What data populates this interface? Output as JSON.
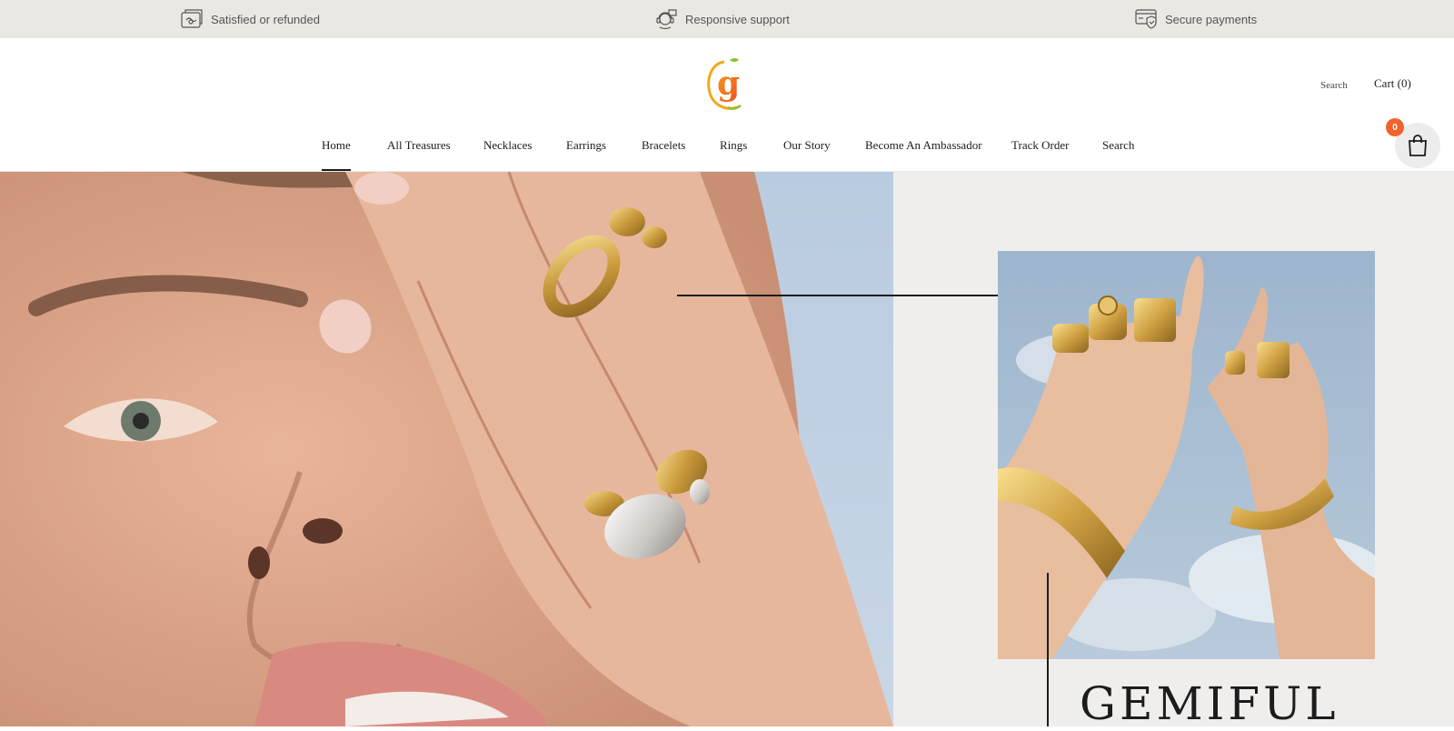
{
  "topbar": {
    "items": [
      {
        "icon": "refund-icon",
        "label": "Satisfied or refunded"
      },
      {
        "icon": "support-icon",
        "label": "Responsive support"
      },
      {
        "icon": "secure-payment-icon",
        "label": "Secure payments"
      }
    ]
  },
  "header": {
    "logo_alt": "g",
    "search_label": "Search",
    "cart_label": "Cart (0)"
  },
  "nav": {
    "items": [
      {
        "label": "Home",
        "active": true
      },
      {
        "label": "All Treasures"
      },
      {
        "label": "Necklaces"
      },
      {
        "label": "Earrings"
      },
      {
        "label": "Bracelets"
      },
      {
        "label": "Rings"
      },
      {
        "label": "Our Story"
      },
      {
        "label": "Become An Ambassador"
      },
      {
        "label": "Track Order"
      },
      {
        "label": "Search"
      }
    ]
  },
  "cart_bubble": {
    "count": "0",
    "icon": "shopping-bag-icon"
  },
  "hero": {
    "title": "GEMIFUL"
  },
  "colors": {
    "topbar_bg": "#ebe8e4",
    "accent": "#f1632c",
    "hero_right_bg": "#efeeec",
    "text": "#1c1c1c"
  }
}
